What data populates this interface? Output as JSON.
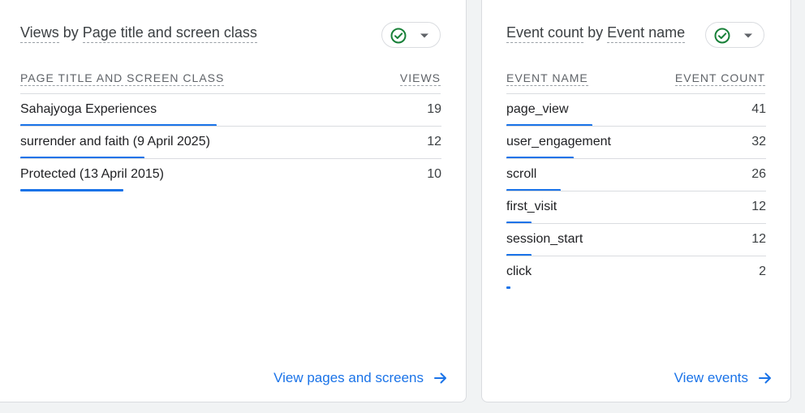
{
  "left_card": {
    "title_part1": "Views",
    "title_part2": "by",
    "title_part3": "Page title and screen class",
    "col_dimension": "PAGE TITLE AND SCREEN CLASS",
    "col_metric": "VIEWS",
    "rows": [
      {
        "label": "Sahajyoga Experiences",
        "value": "19",
        "fraction": 1.0
      },
      {
        "label": "surrender and faith (9 April 2025)",
        "value": "12",
        "fraction": 0.632
      },
      {
        "label": "Protected (13 April 2015)",
        "value": "10",
        "fraction": 0.526
      }
    ],
    "footer_link": "View pages and screens"
  },
  "right_card": {
    "title_part1": "Event count",
    "title_part2": "by",
    "title_part3": "Event name",
    "col_dimension": "EVENT NAME",
    "col_metric": "EVENT COUNT",
    "rows": [
      {
        "label": "page_view",
        "value": "41",
        "fraction": 1.0
      },
      {
        "label": "user_engagement",
        "value": "32",
        "fraction": 0.78
      },
      {
        "label": "scroll",
        "value": "26",
        "fraction": 0.634
      },
      {
        "label": "first_visit",
        "value": "12",
        "fraction": 0.293
      },
      {
        "label": "session_start",
        "value": "12",
        "fraction": 0.293
      },
      {
        "label": "click",
        "value": "2",
        "fraction": 0.049
      }
    ],
    "footer_link": "View events"
  },
  "icons": {
    "status": "check-circle-icon",
    "dropdown": "caret-down-icon",
    "link_arrow": "arrow-right-icon"
  },
  "colors": {
    "accent": "#1a73e8",
    "check_green": "#188038",
    "background": "#f1f3f4"
  }
}
